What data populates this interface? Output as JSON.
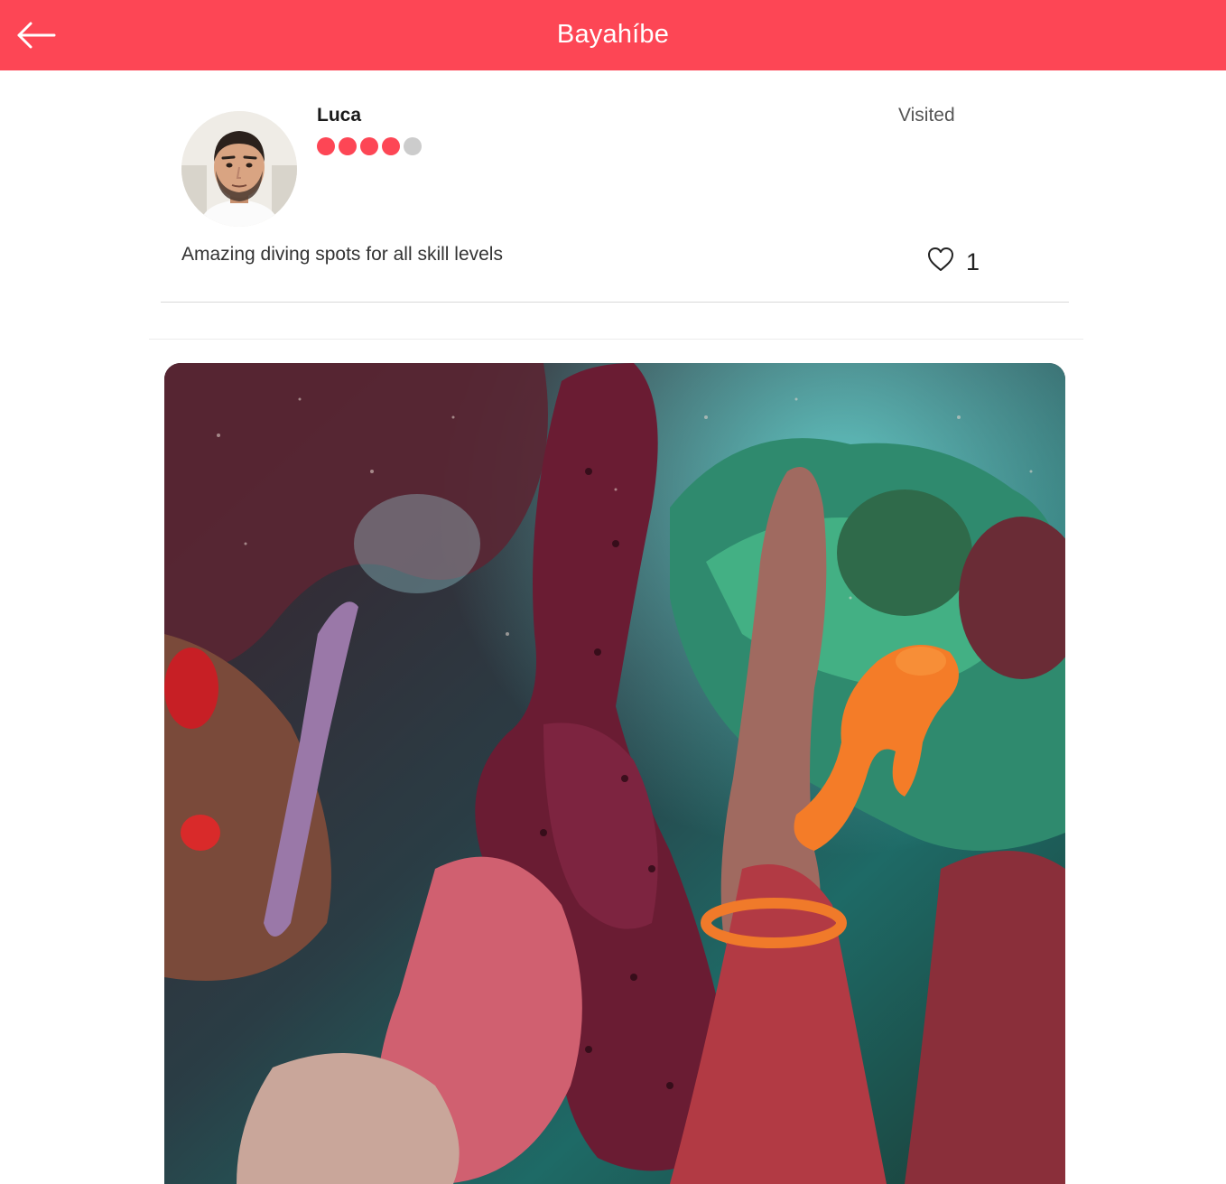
{
  "appbar": {
    "title": "Bayahíbe",
    "background": "#fd4655",
    "back_icon": "arrow-left-icon"
  },
  "review": {
    "author": "Luca",
    "rating": 4,
    "rating_max": 5,
    "rating_color": "#fd4655",
    "rating_empty_color": "#cccccc",
    "status": "Visited",
    "text": "Amazing diving spots for all skill levels",
    "like_icon": "heart-outline-icon",
    "likes": "1"
  },
  "photo": {
    "subject": "underwater coral reef with orange seahorse"
  }
}
